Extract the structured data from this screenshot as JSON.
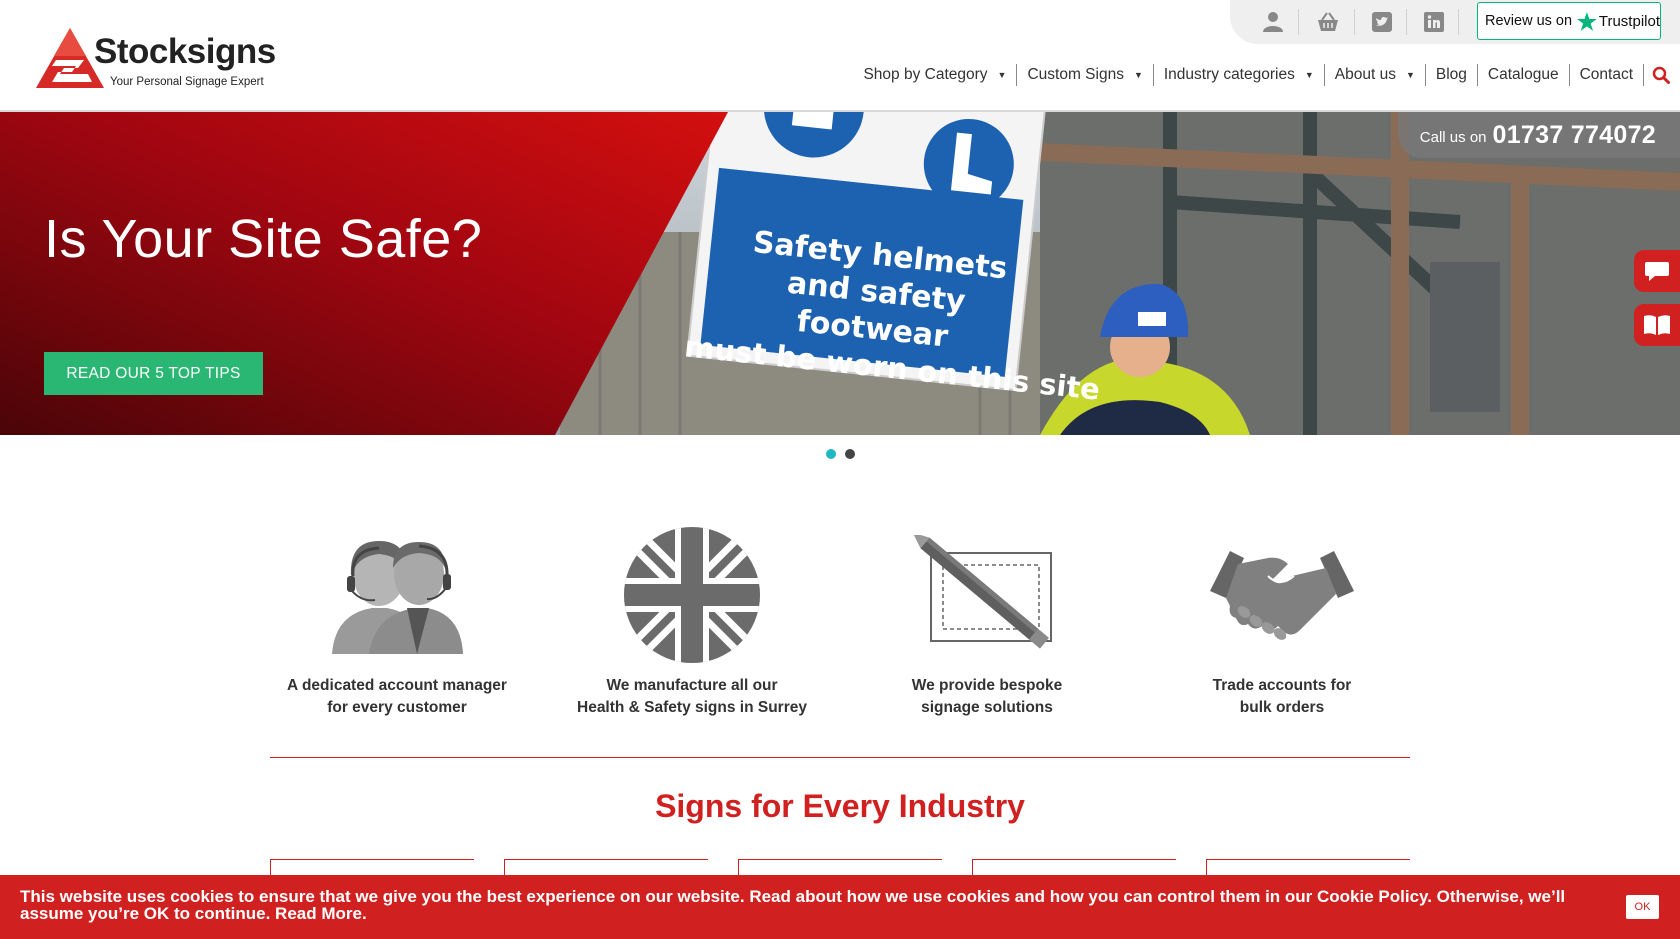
{
  "brand": {
    "name": "Stocksigns",
    "tagline": "Your Personal Signage Expert"
  },
  "topbar": {
    "icons": [
      "user-icon",
      "basket-icon",
      "twitter-icon",
      "linkedin-icon"
    ],
    "trustpilot_prefix": "Review us on",
    "trustpilot_brand": "Trustpilot"
  },
  "nav": {
    "items": [
      {
        "label": "Shop by Category",
        "dropdown": true
      },
      {
        "label": "Custom Signs",
        "dropdown": true
      },
      {
        "label": "Industry categories",
        "dropdown": true
      },
      {
        "label": "About us",
        "dropdown": true
      },
      {
        "label": "Blog",
        "dropdown": false
      },
      {
        "label": "Catalogue",
        "dropdown": false
      },
      {
        "label": "Contact",
        "dropdown": false
      }
    ],
    "search_icon": "search-icon"
  },
  "hero": {
    "title": "Is Your Site Safe?",
    "button_label": "READ OUR 5 TOP TIPS",
    "call_label": "Call us on",
    "call_number": "01737 774072",
    "sign_text": [
      "Safety helmets",
      "and safety footwear",
      "must be worn on this site"
    ],
    "slides_total": 2,
    "active_slide": 1
  },
  "side_tabs": [
    "chat-icon",
    "catalogue-book-icon"
  ],
  "features": [
    {
      "icon": "account-managers-icon",
      "text": "A dedicated account manager\nfor every customer"
    },
    {
      "icon": "union-jack-icon",
      "text": "We manufacture all our\nHealth & Safety signs in Surrey"
    },
    {
      "icon": "pencil-design-icon",
      "text": "We provide bespoke\nsignage solutions"
    },
    {
      "icon": "handshake-icon",
      "text": "Trade accounts for\nbulk orders"
    }
  ],
  "section": {
    "title": "Signs for Every Industry"
  },
  "cookie": {
    "text": "This website uses cookies to ensure that we give you the best experience on our website. Read about how we use cookies and how you can control them in our Cookie Policy. Otherwise, we’ll assume you’re OK to continue. Read More.",
    "ok_label": "OK"
  },
  "colors": {
    "brand_red": "#d0201f",
    "cta_green": "#2ab673",
    "trustpilot_green": "#00b67a",
    "active_dot": "#1fb7c3"
  }
}
